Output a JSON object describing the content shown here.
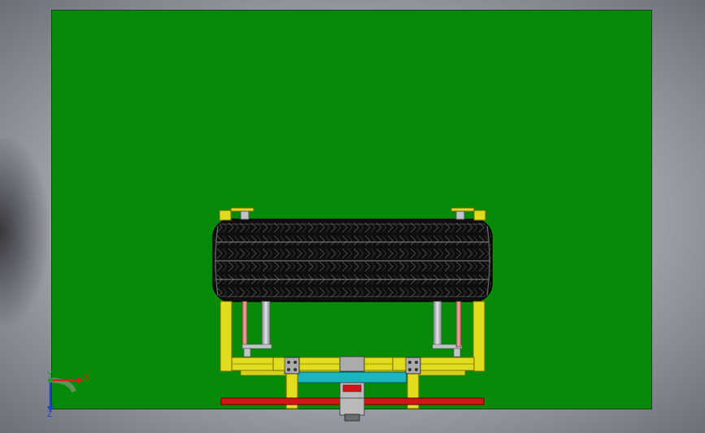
{
  "viewport": {
    "background_top": "#c9ccd2",
    "background_edge": "#6b6f78"
  },
  "plane": {
    "color": "#078a07",
    "border": "#1f3f1f"
  },
  "model": {
    "frame_color": "#e1dc1e",
    "frame_edge": "#6f6a00",
    "tire_color": "#0e0e0e",
    "tire_highlight": "#8a8a8a",
    "rod_red": "#e9928d",
    "rod_gray": "#bfc4c8",
    "platform_color": "#19b6c0",
    "rail_color": "#d01616",
    "bracket_color": "#a9abad"
  },
  "triad": {
    "x_label": "X",
    "y_label": "Y",
    "z_label": "Z",
    "x_color": "#d42020",
    "y_color": "#20a020",
    "z_color": "#2040c8"
  }
}
